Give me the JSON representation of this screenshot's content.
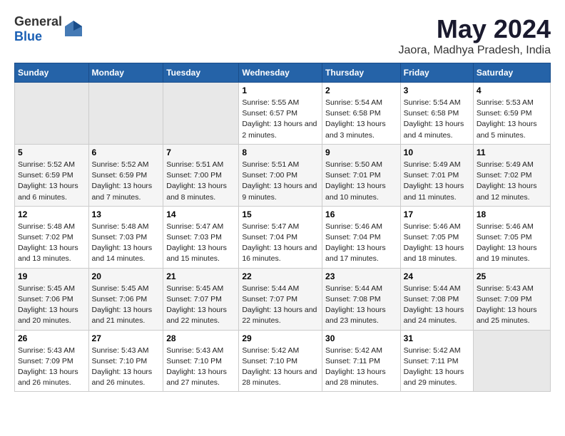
{
  "header": {
    "logo_general": "General",
    "logo_blue": "Blue",
    "title": "May 2024",
    "subtitle": "Jaora, Madhya Pradesh, India"
  },
  "calendar": {
    "days_of_week": [
      "Sunday",
      "Monday",
      "Tuesday",
      "Wednesday",
      "Thursday",
      "Friday",
      "Saturday"
    ],
    "weeks": [
      [
        {
          "day": "",
          "empty": true
        },
        {
          "day": "",
          "empty": true
        },
        {
          "day": "",
          "empty": true
        },
        {
          "day": "1",
          "sunrise": "5:55 AM",
          "sunset": "6:57 PM",
          "daylight": "13 hours and 2 minutes."
        },
        {
          "day": "2",
          "sunrise": "5:54 AM",
          "sunset": "6:58 PM",
          "daylight": "13 hours and 3 minutes."
        },
        {
          "day": "3",
          "sunrise": "5:54 AM",
          "sunset": "6:58 PM",
          "daylight": "13 hours and 4 minutes."
        },
        {
          "day": "4",
          "sunrise": "5:53 AM",
          "sunset": "6:59 PM",
          "daylight": "13 hours and 5 minutes."
        }
      ],
      [
        {
          "day": "5",
          "sunrise": "5:52 AM",
          "sunset": "6:59 PM",
          "daylight": "13 hours and 6 minutes."
        },
        {
          "day": "6",
          "sunrise": "5:52 AM",
          "sunset": "6:59 PM",
          "daylight": "13 hours and 7 minutes."
        },
        {
          "day": "7",
          "sunrise": "5:51 AM",
          "sunset": "7:00 PM",
          "daylight": "13 hours and 8 minutes."
        },
        {
          "day": "8",
          "sunrise": "5:51 AM",
          "sunset": "7:00 PM",
          "daylight": "13 hours and 9 minutes."
        },
        {
          "day": "9",
          "sunrise": "5:50 AM",
          "sunset": "7:01 PM",
          "daylight": "13 hours and 10 minutes."
        },
        {
          "day": "10",
          "sunrise": "5:49 AM",
          "sunset": "7:01 PM",
          "daylight": "13 hours and 11 minutes."
        },
        {
          "day": "11",
          "sunrise": "5:49 AM",
          "sunset": "7:02 PM",
          "daylight": "13 hours and 12 minutes."
        }
      ],
      [
        {
          "day": "12",
          "sunrise": "5:48 AM",
          "sunset": "7:02 PM",
          "daylight": "13 hours and 13 minutes."
        },
        {
          "day": "13",
          "sunrise": "5:48 AM",
          "sunset": "7:03 PM",
          "daylight": "13 hours and 14 minutes."
        },
        {
          "day": "14",
          "sunrise": "5:47 AM",
          "sunset": "7:03 PM",
          "daylight": "13 hours and 15 minutes."
        },
        {
          "day": "15",
          "sunrise": "5:47 AM",
          "sunset": "7:04 PM",
          "daylight": "13 hours and 16 minutes."
        },
        {
          "day": "16",
          "sunrise": "5:46 AM",
          "sunset": "7:04 PM",
          "daylight": "13 hours and 17 minutes."
        },
        {
          "day": "17",
          "sunrise": "5:46 AM",
          "sunset": "7:05 PM",
          "daylight": "13 hours and 18 minutes."
        },
        {
          "day": "18",
          "sunrise": "5:46 AM",
          "sunset": "7:05 PM",
          "daylight": "13 hours and 19 minutes."
        }
      ],
      [
        {
          "day": "19",
          "sunrise": "5:45 AM",
          "sunset": "7:06 PM",
          "daylight": "13 hours and 20 minutes."
        },
        {
          "day": "20",
          "sunrise": "5:45 AM",
          "sunset": "7:06 PM",
          "daylight": "13 hours and 21 minutes."
        },
        {
          "day": "21",
          "sunrise": "5:45 AM",
          "sunset": "7:07 PM",
          "daylight": "13 hours and 22 minutes."
        },
        {
          "day": "22",
          "sunrise": "5:44 AM",
          "sunset": "7:07 PM",
          "daylight": "13 hours and 22 minutes."
        },
        {
          "day": "23",
          "sunrise": "5:44 AM",
          "sunset": "7:08 PM",
          "daylight": "13 hours and 23 minutes."
        },
        {
          "day": "24",
          "sunrise": "5:44 AM",
          "sunset": "7:08 PM",
          "daylight": "13 hours and 24 minutes."
        },
        {
          "day": "25",
          "sunrise": "5:43 AM",
          "sunset": "7:09 PM",
          "daylight": "13 hours and 25 minutes."
        }
      ],
      [
        {
          "day": "26",
          "sunrise": "5:43 AM",
          "sunset": "7:09 PM",
          "daylight": "13 hours and 26 minutes."
        },
        {
          "day": "27",
          "sunrise": "5:43 AM",
          "sunset": "7:10 PM",
          "daylight": "13 hours and 26 minutes."
        },
        {
          "day": "28",
          "sunrise": "5:43 AM",
          "sunset": "7:10 PM",
          "daylight": "13 hours and 27 minutes."
        },
        {
          "day": "29",
          "sunrise": "5:42 AM",
          "sunset": "7:10 PM",
          "daylight": "13 hours and 28 minutes."
        },
        {
          "day": "30",
          "sunrise": "5:42 AM",
          "sunset": "7:11 PM",
          "daylight": "13 hours and 28 minutes."
        },
        {
          "day": "31",
          "sunrise": "5:42 AM",
          "sunset": "7:11 PM",
          "daylight": "13 hours and 29 minutes."
        },
        {
          "day": "",
          "empty": true
        }
      ]
    ]
  }
}
